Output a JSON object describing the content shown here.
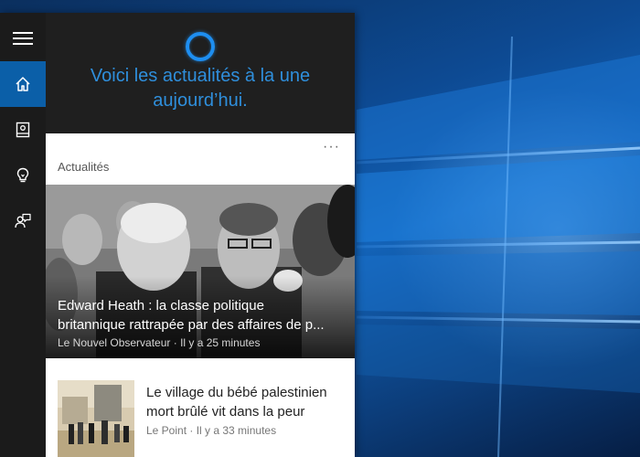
{
  "cortana": {
    "greeting_line1": "Voici les actualités à la une",
    "greeting_line2": "aujourd’hui."
  },
  "rail": {
    "items": [
      {
        "name": "menu",
        "icon": "hamburger-icon"
      },
      {
        "name": "home",
        "icon": "home-icon",
        "active": true
      },
      {
        "name": "notebook",
        "icon": "notebook-icon"
      },
      {
        "name": "tips",
        "icon": "lightbulb-icon"
      },
      {
        "name": "feedback",
        "icon": "feedback-icon"
      }
    ]
  },
  "news_card": {
    "title": "Actualités",
    "more_label": "···",
    "headline": {
      "title_line1": "Edward Heath : la classe politique",
      "title_line2": "britannique rattrapée par des affaires de p...",
      "source": "Le Nouvel Observateur · Il y a 25 minutes"
    },
    "items": [
      {
        "title": "Le village du bébé palestinien mort brûlé vit dans la peur",
        "source": "Le Point · Il y a 33 minutes"
      }
    ]
  },
  "colors": {
    "accent": "#0b5fa8",
    "cortana_blue": "#2f8fdc",
    "panel_bg": "#1f1f1f"
  }
}
